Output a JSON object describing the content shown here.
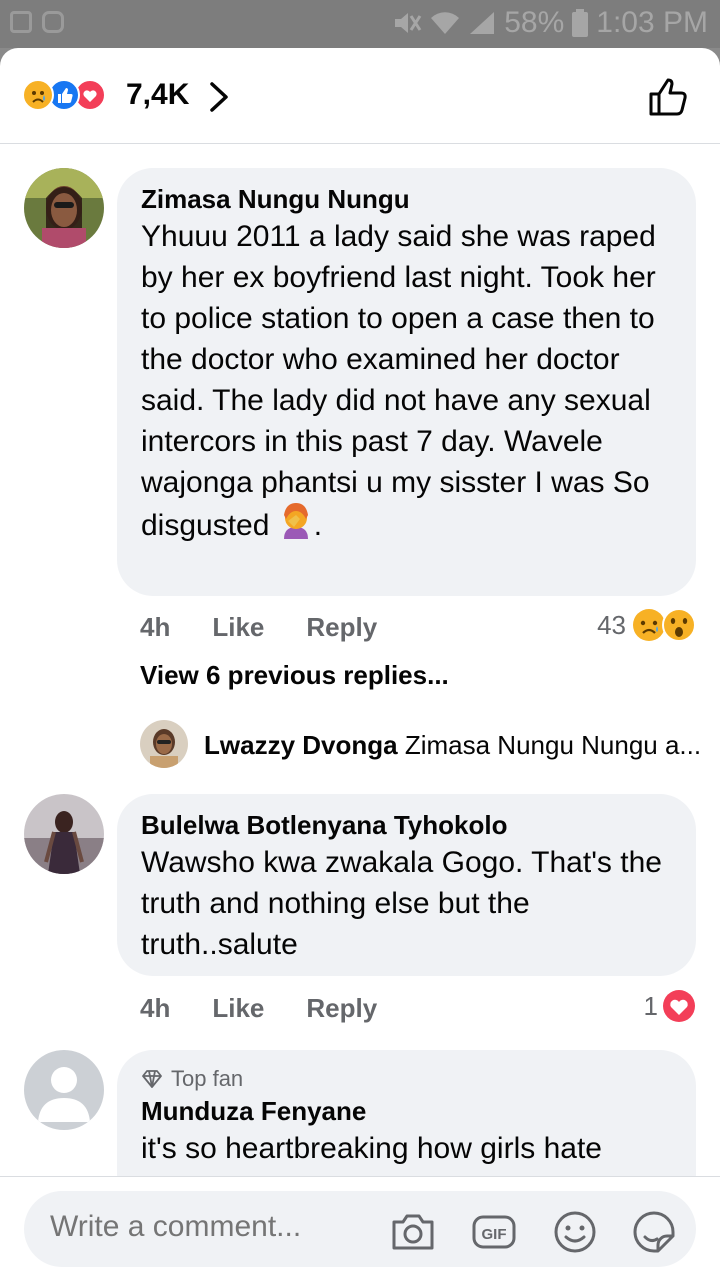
{
  "status_bar": {
    "battery": "58%",
    "time": "1:03 PM"
  },
  "header": {
    "reaction_count": "7,4K",
    "reaction_icons": [
      "sad-face",
      "like-thumb",
      "love-heart"
    ]
  },
  "comments": [
    {
      "name": "Zimasa Nungu Nungu",
      "text": "Yhuuu 2011  a lady said she was raped by her ex boyfriend last night. Took her to police station to open a case then to the doctor who examined her doctor said. The lady did not have any sexual intercors in this past 7 day. Wavele wajonga phantsi u my sisster I was So disgusted",
      "trailing_emoji": "facepalm-woman",
      "time": "4h",
      "like": "Like",
      "reply": "Reply",
      "reaction_count": "43",
      "reaction_icons": [
        "sad-face",
        "wow-face"
      ]
    },
    {
      "name": "Bulelwa Botlenyana Tyhokolo",
      "text": "Wawsho kwa zwakala Gogo. That's the truth and nothing else but the truth..salute",
      "time": "4h",
      "like": "Like",
      "reply": "Reply",
      "reaction_count": "1",
      "reaction_icons": [
        "love-heart"
      ]
    },
    {
      "badge": "Top fan",
      "name": "Munduza Fenyane",
      "text": "it's so heartbreaking how girls hate"
    }
  ],
  "replies": {
    "view_previous": "View 6 previous replies...",
    "latest_name": "Lwazzy Dvonga",
    "latest_preview": "Zimasa Nungu Nungu a..."
  },
  "composer": {
    "placeholder": "Write a comment..."
  }
}
